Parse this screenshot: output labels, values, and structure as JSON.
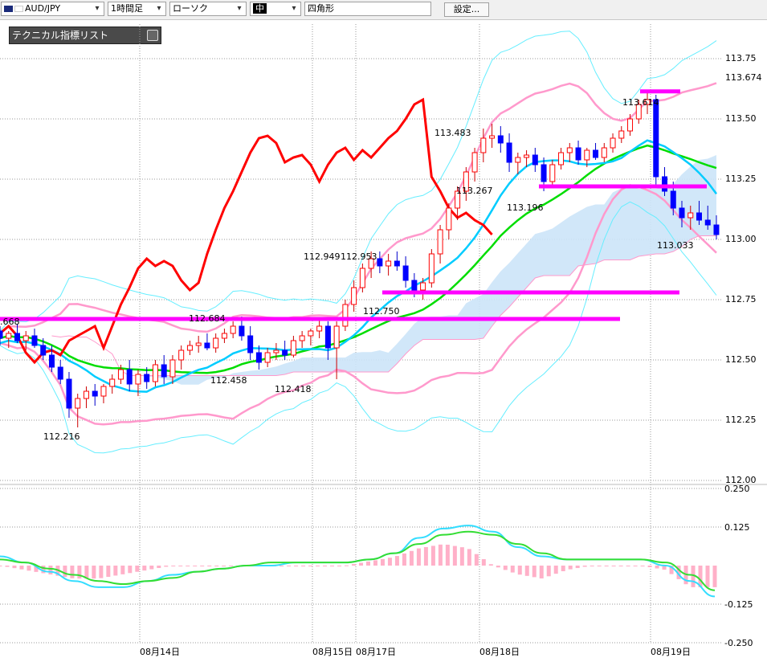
{
  "toolbar": {
    "symbol": "AUD/JPY",
    "timeframe": "1時間足",
    "chart_style": "ローソク",
    "line_style": "中",
    "shape": "四角形",
    "settings_label": "設定..."
  },
  "panel": {
    "title": "テクニカル指標リスト"
  },
  "colors": {
    "up_candle": "#ff0000",
    "down_candle": "#0000ff",
    "bollinger_outer": "#66eeff",
    "bollinger_inner": "#ff99cc",
    "moving_average": "#00dd00",
    "ichimoku_span": "#00ccff",
    "lagging_line": "#ff0000",
    "kumo": "#cce4f8",
    "horizontal_lines": "#ff00ff",
    "macd_line": "#33ddff",
    "signal_line": "#33dd33",
    "histogram": "#ffb0c8"
  },
  "chart_data": [
    {
      "type": "candlestick",
      "title": "",
      "y_ticks": [
        "113.75",
        "113.674",
        "113.50",
        "113.25",
        "113.00",
        "112.75",
        "112.50",
        "112.25",
        "112.00"
      ],
      "ylim": [
        112.0,
        113.9
      ],
      "x_labels": [
        "08月14日",
        "08月15日",
        "08月17日",
        "08月18日",
        "08月19日"
      ],
      "annotations": [
        ".668",
        "112.216",
        "112.684",
        "112.458",
        "112.418",
        "112.949",
        "112.953",
        "112.750",
        "113.483",
        "113.267",
        "113.196",
        "113.614",
        "113.033"
      ],
      "horizontal_lines": [
        {
          "price": 113.614
        },
        {
          "price": 113.22
        },
        {
          "price": 112.78
        },
        {
          "price": 112.67
        }
      ],
      "candles": [
        [
          112.62,
          112.64,
          112.56,
          112.59
        ],
        [
          112.59,
          112.62,
          112.55,
          112.61
        ],
        [
          112.61,
          112.65,
          112.57,
          112.58
        ],
        [
          112.58,
          112.62,
          112.54,
          112.6
        ],
        [
          112.6,
          112.63,
          112.55,
          112.56
        ],
        [
          112.56,
          112.59,
          112.5,
          112.52
        ],
        [
          112.52,
          112.56,
          112.45,
          112.47
        ],
        [
          112.47,
          112.5,
          112.4,
          112.42
        ],
        [
          112.42,
          112.45,
          112.26,
          112.3
        ],
        [
          112.3,
          112.36,
          112.22,
          112.34
        ],
        [
          112.34,
          112.39,
          112.3,
          112.37
        ],
        [
          112.37,
          112.4,
          112.31,
          112.35
        ],
        [
          112.35,
          112.4,
          112.32,
          112.39
        ],
        [
          112.39,
          112.44,
          112.36,
          112.42
        ],
        [
          112.42,
          112.48,
          112.4,
          112.46
        ],
        [
          112.46,
          112.5,
          112.37,
          112.4
        ],
        [
          112.4,
          112.46,
          112.35,
          112.44
        ],
        [
          112.44,
          112.47,
          112.38,
          112.41
        ],
        [
          112.41,
          112.5,
          112.39,
          112.48
        ],
        [
          112.48,
          112.52,
          112.4,
          112.43
        ],
        [
          112.43,
          112.52,
          112.4,
          112.5
        ],
        [
          112.5,
          112.56,
          112.46,
          112.54
        ],
        [
          112.54,
          112.58,
          112.52,
          112.56
        ],
        [
          112.56,
          112.6,
          112.53,
          112.57
        ],
        [
          112.57,
          112.61,
          112.54,
          112.55
        ],
        [
          112.55,
          112.61,
          112.53,
          112.59
        ],
        [
          112.59,
          112.63,
          112.57,
          112.61
        ],
        [
          112.61,
          112.66,
          112.59,
          112.64
        ],
        [
          112.64,
          112.68,
          112.58,
          112.6
        ],
        [
          112.6,
          112.64,
          112.5,
          112.53
        ],
        [
          112.53,
          112.56,
          112.46,
          112.49
        ],
        [
          112.49,
          112.55,
          112.47,
          112.53
        ],
        [
          112.53,
          112.57,
          112.5,
          112.54
        ],
        [
          112.54,
          112.58,
          112.5,
          112.52
        ],
        [
          112.52,
          112.6,
          112.51,
          112.58
        ],
        [
          112.58,
          112.62,
          112.55,
          112.6
        ],
        [
          112.6,
          112.63,
          112.56,
          112.62
        ],
        [
          112.62,
          112.67,
          112.59,
          112.64
        ],
        [
          112.64,
          112.66,
          112.5,
          112.55
        ],
        [
          112.55,
          112.66,
          112.42,
          112.64
        ],
        [
          112.64,
          112.75,
          112.62,
          112.73
        ],
        [
          112.73,
          112.83,
          112.7,
          112.8
        ],
        [
          112.8,
          112.9,
          112.78,
          112.88
        ],
        [
          112.88,
          112.95,
          112.84,
          112.92
        ],
        [
          112.92,
          112.95,
          112.86,
          112.89
        ],
        [
          112.89,
          112.94,
          112.85,
          112.91
        ],
        [
          112.91,
          112.95,
          112.87,
          112.89
        ],
        [
          112.89,
          112.93,
          112.8,
          112.83
        ],
        [
          112.83,
          112.86,
          112.76,
          112.79
        ],
        [
          112.79,
          112.84,
          112.75,
          112.82
        ],
        [
          112.82,
          112.96,
          112.8,
          112.94
        ],
        [
          112.94,
          113.06,
          112.9,
          113.04
        ],
        [
          113.04,
          113.15,
          113.0,
          113.13
        ],
        [
          113.13,
          113.22,
          113.08,
          113.2
        ],
        [
          113.2,
          113.3,
          113.16,
          113.28
        ],
        [
          113.28,
          113.38,
          113.24,
          113.36
        ],
        [
          113.36,
          113.46,
          113.32,
          113.42
        ],
        [
          113.42,
          113.48,
          113.38,
          113.43
        ],
        [
          113.43,
          113.47,
          113.36,
          113.4
        ],
        [
          113.4,
          113.44,
          113.28,
          113.32
        ],
        [
          113.32,
          113.36,
          113.27,
          113.34
        ],
        [
          113.34,
          113.37,
          113.3,
          113.35
        ],
        [
          113.35,
          113.38,
          113.28,
          113.31
        ],
        [
          113.31,
          113.34,
          113.2,
          113.24
        ],
        [
          113.24,
          113.33,
          113.22,
          113.31
        ],
        [
          113.31,
          113.38,
          113.29,
          113.36
        ],
        [
          113.36,
          113.4,
          113.32,
          113.38
        ],
        [
          113.38,
          113.41,
          113.31,
          113.33
        ],
        [
          113.33,
          113.38,
          113.3,
          113.37
        ],
        [
          113.37,
          113.4,
          113.33,
          113.34
        ],
        [
          113.34,
          113.4,
          113.32,
          113.38
        ],
        [
          113.38,
          113.44,
          113.36,
          113.42
        ],
        [
          113.42,
          113.47,
          113.4,
          113.45
        ],
        [
          113.45,
          113.52,
          113.43,
          113.5
        ],
        [
          113.5,
          113.58,
          113.48,
          113.56
        ],
        [
          113.56,
          113.61,
          113.52,
          113.58
        ],
        [
          113.58,
          113.6,
          113.22,
          113.26
        ],
        [
          113.26,
          113.3,
          113.18,
          113.2
        ],
        [
          113.2,
          113.24,
          113.1,
          113.13
        ],
        [
          113.13,
          113.16,
          113.05,
          113.09
        ],
        [
          113.09,
          113.14,
          113.04,
          113.11
        ],
        [
          113.11,
          113.16,
          113.06,
          113.08
        ],
        [
          113.08,
          113.14,
          113.04,
          113.06
        ],
        [
          113.06,
          113.1,
          113.0,
          113.02
        ]
      ]
    },
    {
      "type": "line",
      "title": "",
      "y_ticks": [
        "0.250",
        "0.125",
        "-0.125",
        "-0.250"
      ],
      "ylim": [
        -0.25,
        0.25
      ],
      "series": [
        {
          "values": [
            0.03,
            0.01,
            -0.02,
            -0.05,
            -0.07,
            -0.07,
            -0.05,
            -0.03,
            -0.02,
            -0.01,
            0.0,
            0.0,
            0.01,
            0.01,
            0.01,
            0.02,
            0.04,
            0.09,
            0.12,
            0.13,
            0.11,
            0.06,
            0.03,
            0.02,
            0.02,
            0.02,
            0.02,
            0.0,
            -0.05,
            -0.1
          ]
        },
        {
          "values": [
            0.02,
            0.01,
            -0.01,
            -0.03,
            -0.05,
            -0.06,
            -0.05,
            -0.04,
            -0.02,
            -0.01,
            0.0,
            0.01,
            0.01,
            0.01,
            0.01,
            0.02,
            0.04,
            0.07,
            0.1,
            0.11,
            0.1,
            0.07,
            0.04,
            0.02,
            0.02,
            0.02,
            0.02,
            0.01,
            -0.03,
            -0.08
          ]
        },
        {
          "values": [
            0.0,
            -0.01,
            -0.02,
            -0.03,
            -0.03,
            -0.02,
            -0.01,
            0.0,
            0.0,
            0.0,
            0.0,
            0.0,
            0.0,
            0.0,
            0.0,
            0.01,
            0.02,
            0.04,
            0.05,
            0.04,
            0.0,
            -0.02,
            -0.03,
            -0.01,
            0.0,
            0.0,
            0.0,
            -0.01,
            -0.05,
            -0.05
          ]
        }
      ]
    }
  ]
}
